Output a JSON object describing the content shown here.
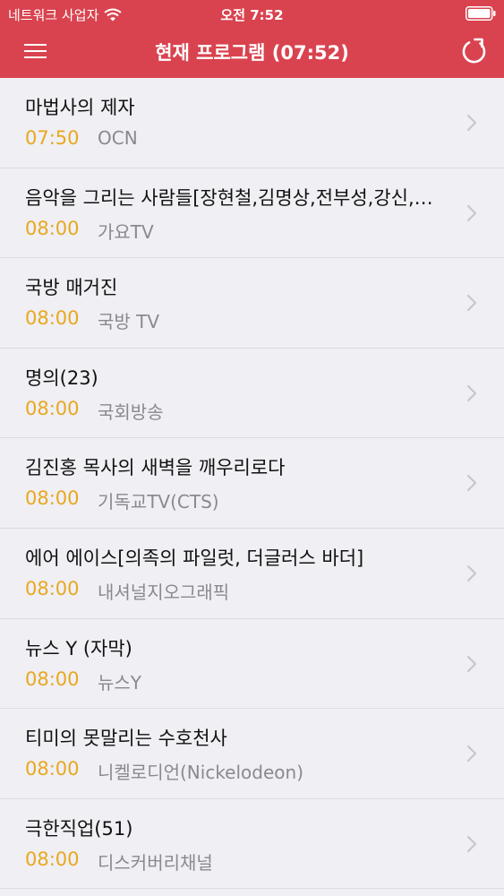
{
  "status_bar": {
    "carrier": "네트워크 사업자",
    "time": "오전 7:52"
  },
  "nav": {
    "title": "현재 프로그램 (07:52)"
  },
  "accent_color": "#d9434f",
  "time_color": "#e9a81e",
  "icons": [
    "wifi-icon",
    "battery-icon",
    "menu-icon",
    "refresh-icon",
    "chevron-right-icon"
  ],
  "programs": [
    {
      "title": "마법사의 제자",
      "time": "07:50",
      "channel": "OCN"
    },
    {
      "title": "음악을 그리는 사람들[장현철,김명상,전부성,강신,…",
      "time": "08:00",
      "channel": "가요TV"
    },
    {
      "title": "국방 매거진",
      "time": "08:00",
      "channel": "국방 TV"
    },
    {
      "title": "명의(23)",
      "time": "08:00",
      "channel": "국회방송"
    },
    {
      "title": "김진홍 목사의 새벽을 깨우리로다",
      "time": "08:00",
      "channel": "기독교TV(CTS)"
    },
    {
      "title": "에어 에이스[의족의 파일럿, 더글러스 바더]",
      "time": "08:00",
      "channel": "내셔널지오그래픽"
    },
    {
      "title": "뉴스 Y (자막)",
      "time": "08:00",
      "channel": "뉴스Y"
    },
    {
      "title": "티미의 못말리는 수호천사",
      "time": "08:00",
      "channel": "니켈로디언(Nickelodeon)"
    },
    {
      "title": "극한직업(51)",
      "time": "08:00",
      "channel": "디스커버리채널"
    }
  ]
}
